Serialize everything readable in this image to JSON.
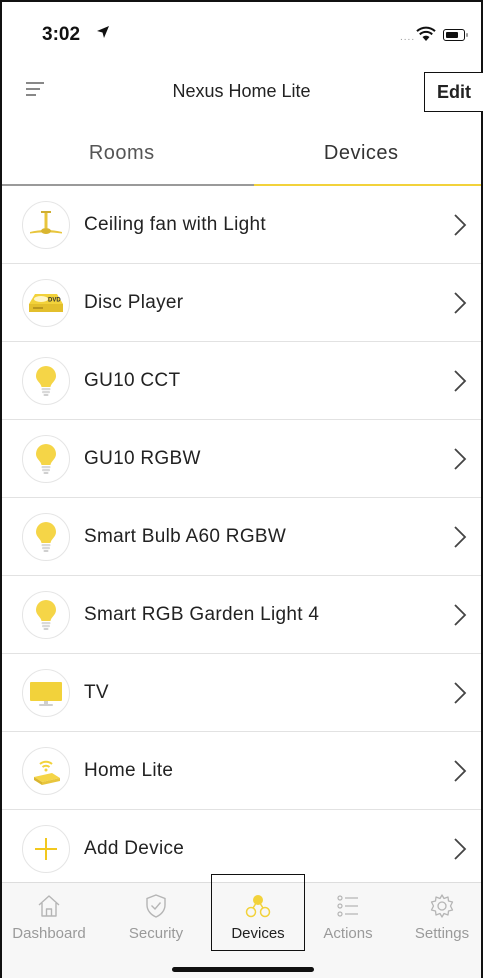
{
  "status_bar": {
    "time": "3:02"
  },
  "header": {
    "title": "Nexus Home Lite",
    "edit_label": "Edit"
  },
  "tabs": [
    {
      "label": "Rooms",
      "selected": false
    },
    {
      "label": "Devices",
      "selected": true
    }
  ],
  "devices": [
    {
      "label": "Ceiling fan with Light",
      "icon": "ceiling-fan-icon"
    },
    {
      "label": "Disc Player",
      "icon": "disc-player-icon",
      "icon_text": "DVD"
    },
    {
      "label": "GU10 CCT",
      "icon": "bulb-icon"
    },
    {
      "label": "GU10 RGBW",
      "icon": "bulb-icon"
    },
    {
      "label": "Smart Bulb A60 RGBW",
      "icon": "bulb-icon"
    },
    {
      "label": "Smart RGB Garden Light 4",
      "icon": "bulb-icon"
    },
    {
      "label": "TV",
      "icon": "tv-icon"
    },
    {
      "label": "Home Lite",
      "icon": "home-lite-hub-icon"
    },
    {
      "label": "Add Device",
      "icon": "plus-icon"
    }
  ],
  "tabbar": [
    {
      "label": "Dashboard",
      "icon": "home-icon",
      "active": false
    },
    {
      "label": "Security",
      "icon": "shield-icon",
      "active": false
    },
    {
      "label": "Devices",
      "icon": "devices-icon",
      "active": true
    },
    {
      "label": "Actions",
      "icon": "actions-list-icon",
      "active": false
    },
    {
      "label": "Settings",
      "icon": "gear-icon",
      "active": false
    }
  ],
  "colors": {
    "accent": "#f2d23b",
    "icon_yellow": "#f5d547",
    "text": "#222222",
    "muted": "#9a9a9a"
  }
}
